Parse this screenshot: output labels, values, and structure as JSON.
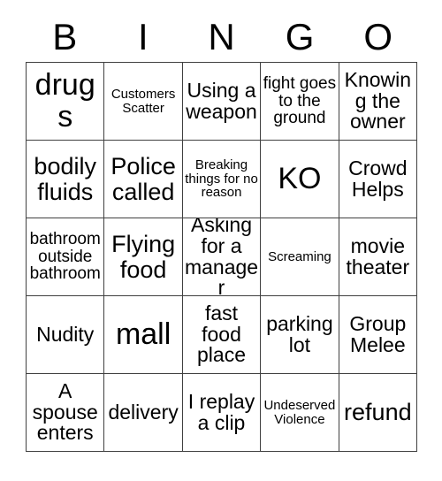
{
  "card": {
    "header": {
      "letters": [
        "B",
        "I",
        "N",
        "G",
        "O"
      ]
    },
    "rows": [
      [
        {
          "text": "drugs",
          "size": "fs-xl"
        },
        {
          "text": "Customers Scatter",
          "size": "fs-xs"
        },
        {
          "text": "Using a weapon",
          "size": "fs-md"
        },
        {
          "text": "fight goes to the ground",
          "size": "fs-sm"
        },
        {
          "text": "Knowing the owner",
          "size": "fs-md"
        }
      ],
      [
        {
          "text": "bodily fluids",
          "size": "fs-lg"
        },
        {
          "text": "Police called",
          "size": "fs-lg"
        },
        {
          "text": "Breaking things for no reason",
          "size": "fs-xs"
        },
        {
          "text": "KO",
          "size": "fs-xl"
        },
        {
          "text": "Crowd Helps",
          "size": "fs-md"
        }
      ],
      [
        {
          "text": "bathroom outside bathroom",
          "size": "fs-sm"
        },
        {
          "text": "Flying food",
          "size": "fs-lg"
        },
        {
          "text": "Asking for a manager",
          "size": "fs-md"
        },
        {
          "text": "Screaming",
          "size": "fs-xs"
        },
        {
          "text": "movie theater",
          "size": "fs-md"
        }
      ],
      [
        {
          "text": "Nudity",
          "size": "fs-md"
        },
        {
          "text": "mall",
          "size": "fs-xl"
        },
        {
          "text": "fast food place",
          "size": "fs-md"
        },
        {
          "text": "parking lot",
          "size": "fs-md"
        },
        {
          "text": "Group Melee",
          "size": "fs-md"
        }
      ],
      [
        {
          "text": "A spouse enters",
          "size": "fs-md"
        },
        {
          "text": "delivery",
          "size": "fs-md"
        },
        {
          "text": "I replay a clip",
          "size": "fs-md"
        },
        {
          "text": "Undeserved Violence",
          "size": "fs-xs"
        },
        {
          "text": "refund",
          "size": "fs-lg"
        }
      ]
    ]
  },
  "colors": {
    "background": "#ffffff",
    "text": "#000000",
    "border": "#404040"
  }
}
